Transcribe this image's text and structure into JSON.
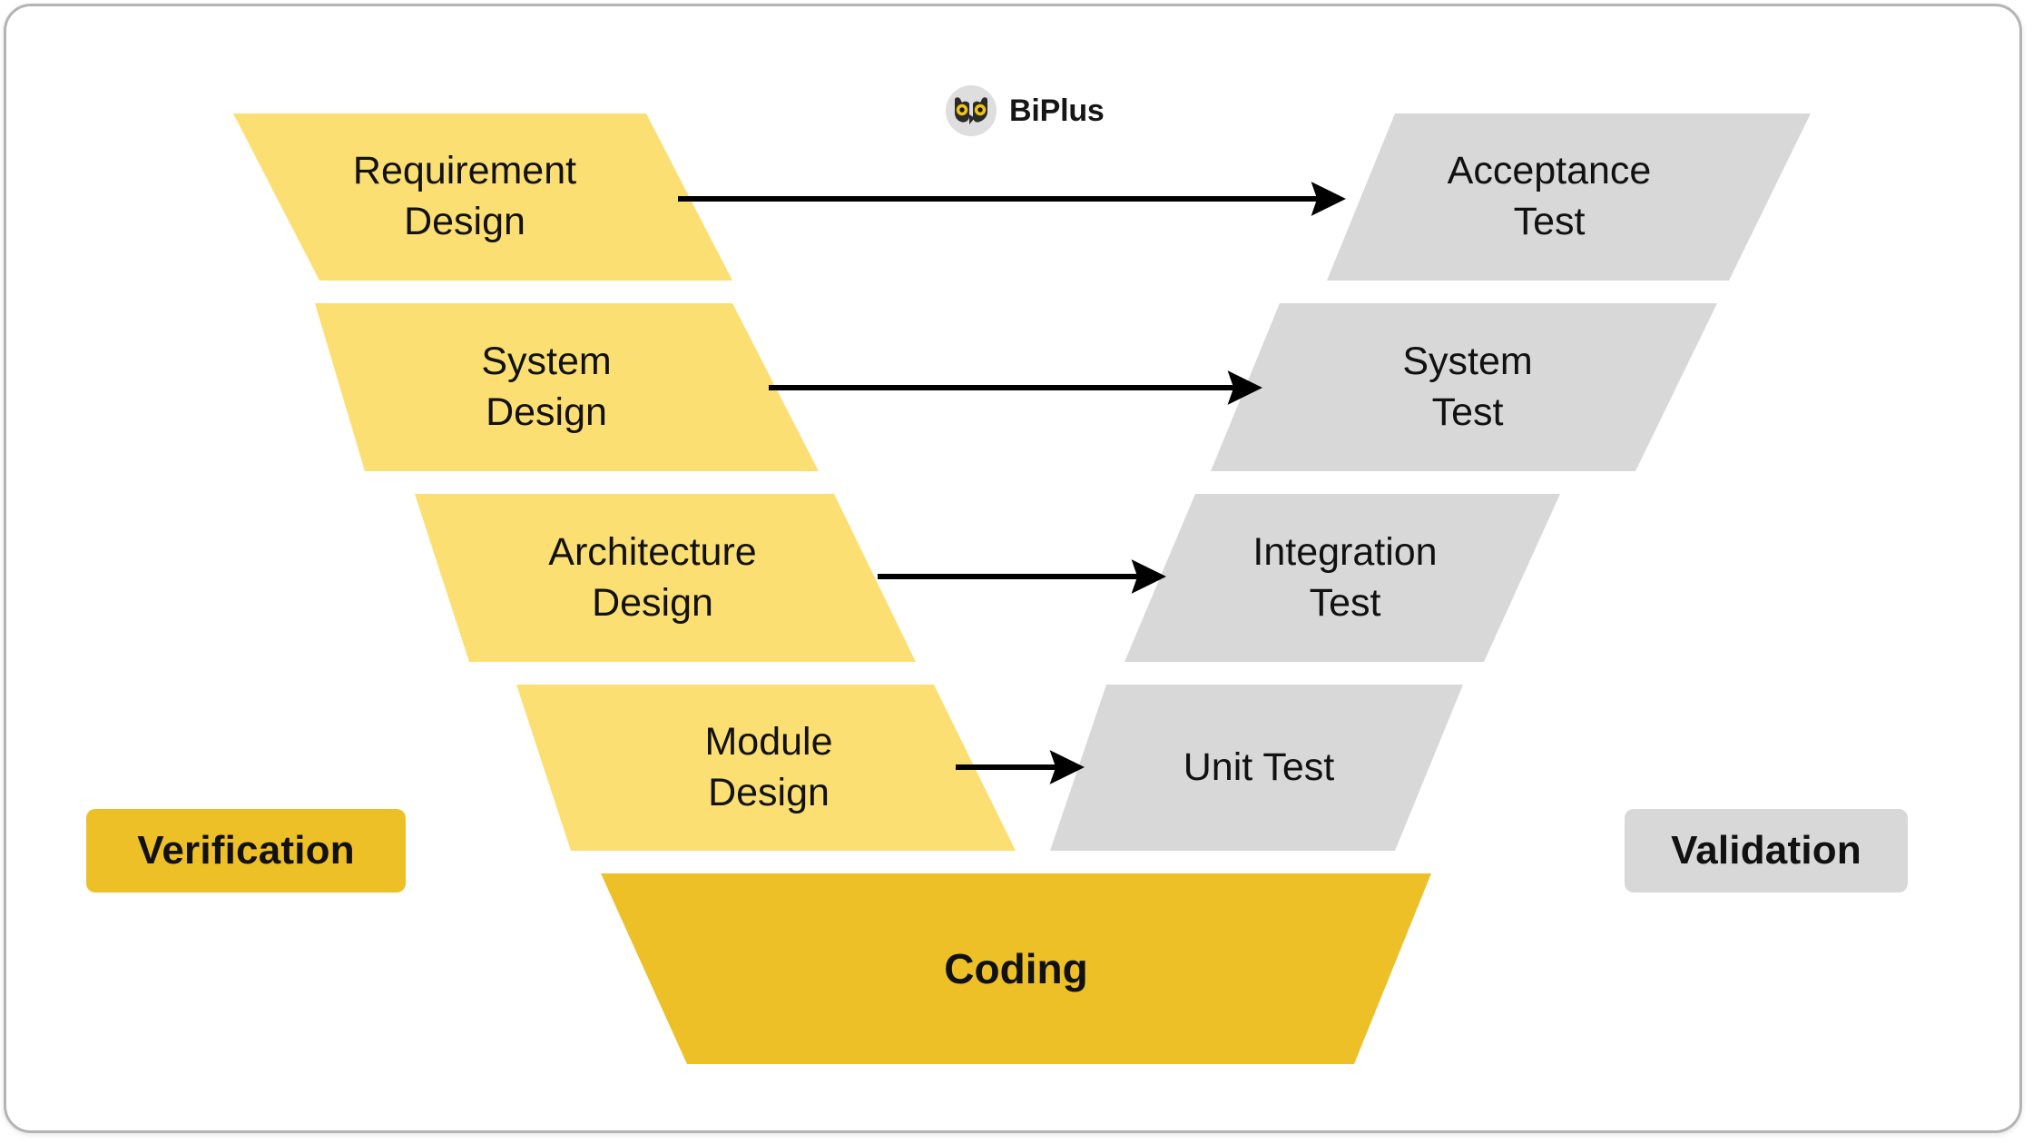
{
  "brand": {
    "name": "BiPlus",
    "logo_icon": "owl-bp-logo-icon"
  },
  "colors": {
    "design_fill": "#fcdf72",
    "test_fill": "#d8d8d8",
    "coding_fill": "#eec028",
    "verification_badge": "#eec028",
    "validation_badge": "#d8d8d8",
    "arrow": "#000000",
    "text": "#111111",
    "canvas_border": "#b4b4b4"
  },
  "diagram": {
    "type": "v-model",
    "left_column_title": "Verification",
    "right_column_title": "Validation",
    "bottom_stage": "Coding",
    "rows": [
      {
        "design": "Requirement\nDesign",
        "design_line1": "Requirement",
        "design_line2": "Design",
        "test": "Acceptance\nTest",
        "test_line1": "Acceptance",
        "test_line2": "Test",
        "arrow": "design-to-test"
      },
      {
        "design": "System\nDesign",
        "design_line1": "System",
        "design_line2": "Design",
        "test": "System\nTest",
        "test_line1": "System",
        "test_line2": "Test",
        "arrow": "design-to-test"
      },
      {
        "design": "Architecture\nDesign",
        "design_line1": "Architecture",
        "design_line2": "Design",
        "test": "Integration\nTest",
        "test_line1": "Integration",
        "test_line2": "Test",
        "arrow": "design-to-test"
      },
      {
        "design": "Module\nDesign",
        "design_line1": "Module",
        "design_line2": "Design",
        "test": "Unit Test",
        "test_line1": "Unit Test",
        "test_line2": "",
        "arrow": "design-to-test"
      }
    ]
  }
}
